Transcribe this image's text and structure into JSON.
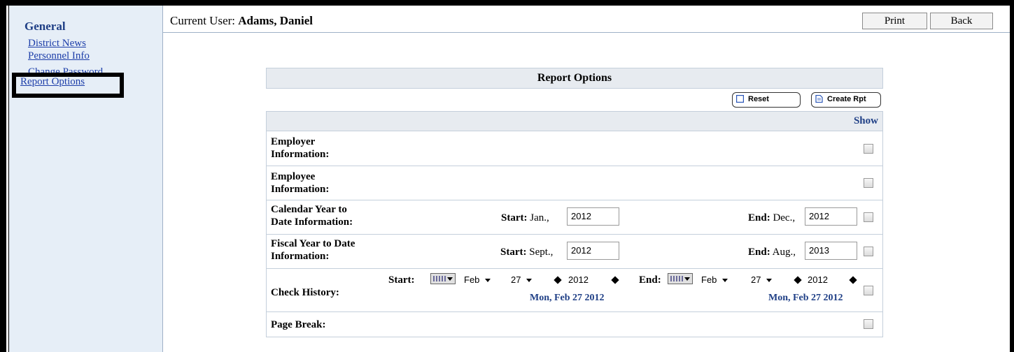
{
  "sidebar": {
    "title": "General",
    "items": [
      {
        "label": "District News"
      },
      {
        "label": "Personnel Info"
      },
      {
        "label": "Change Password"
      },
      {
        "label": "Report Options"
      }
    ]
  },
  "header": {
    "user_prefix": "Current User:",
    "user_name": "Adams, Daniel",
    "print_label": "Print",
    "back_label": "Back"
  },
  "report": {
    "title": "Report Options",
    "reset_label": "Reset",
    "create_label": "Create Rpt",
    "show_label": "Show",
    "rows": [
      {
        "label_line1": "Employer",
        "label_line2": "Information:"
      },
      {
        "label_line1": "Employee",
        "label_line2": "Information:"
      },
      {
        "label_line1": "Calendar Year to",
        "label_line2": "Date Information:",
        "start_label": "Start:",
        "start_prefix": "Jan.,",
        "start_value": "2012",
        "end_label": "End:",
        "end_prefix": "Dec.,",
        "end_value": "2012"
      },
      {
        "label_line1": "Fiscal Year to Date",
        "label_line2": "Information:",
        "start_label": "Start:",
        "start_prefix": "Sept.,",
        "start_value": "2012",
        "end_label": "End:",
        "end_prefix": "Aug.,",
        "end_value": "2013"
      },
      {
        "label_line1": "Check History:",
        "start_label": "Start:",
        "start_month": "Feb",
        "start_day": "27",
        "start_year": "2012",
        "start_date_text": "Mon, Feb 27 2012",
        "end_label": "End:",
        "end_month": "Feb",
        "end_day": "27",
        "end_year": "2012",
        "end_date_text": "Mon, Feb 27 2012"
      },
      {
        "label_line1": "Page Break:"
      }
    ]
  },
  "colors": {
    "sidebar_bg": "#e6eef7",
    "link": "#1d3ea9",
    "heading_blue": "#1f3f86",
    "table_header_bg": "#e7ebf0"
  },
  "icons": [
    "reset-icon",
    "document-icon",
    "calendar-icon",
    "left-arrow-icon",
    "right-arrow-icon",
    "chevron-down-icon"
  ]
}
